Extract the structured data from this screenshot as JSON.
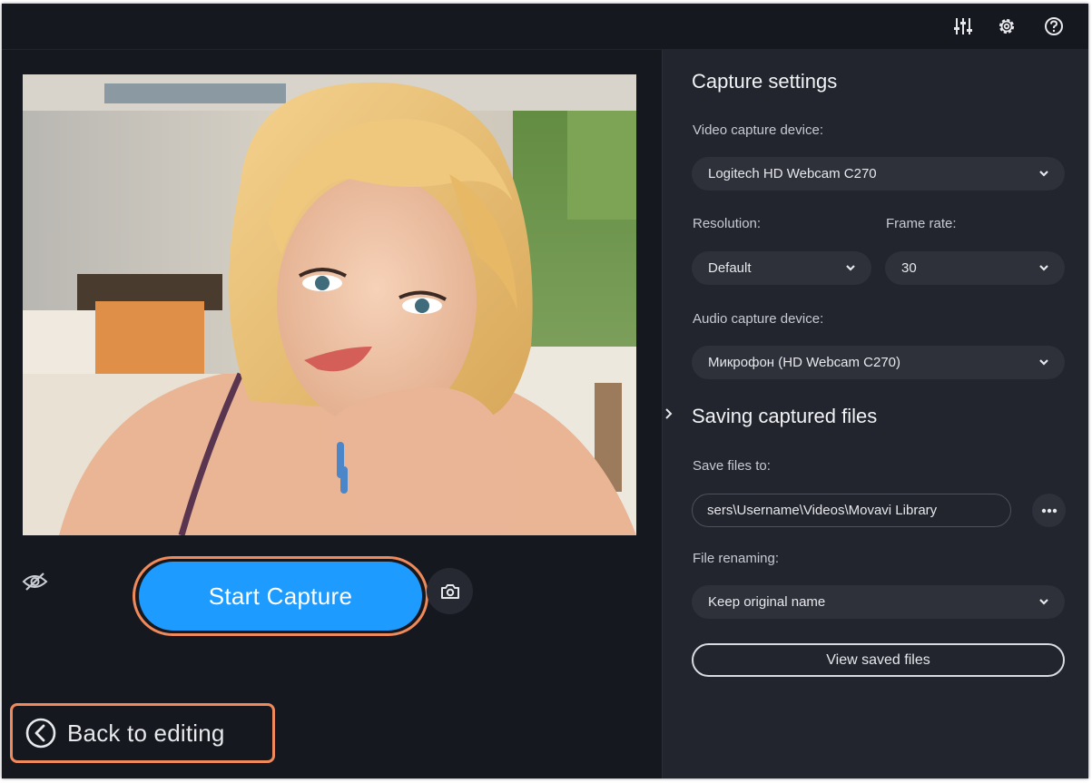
{
  "toolbar": {
    "icons": [
      "mixer-icon",
      "gear-icon",
      "help-icon"
    ]
  },
  "preview": {
    "description_icon": "webcam-preview-image"
  },
  "controls": {
    "start_capture_label": "Start Capture",
    "back_label": "Back to editing",
    "mute_icon": "eye-off-icon",
    "snapshot_icon": "camera-icon"
  },
  "capture_settings": {
    "title": "Capture settings",
    "video_device_label": "Video capture device:",
    "video_device_value": "Logitech HD Webcam C270",
    "resolution_label": "Resolution:",
    "resolution_value": "Default",
    "frame_rate_label": "Frame rate:",
    "frame_rate_value": "30",
    "audio_device_label": "Audio capture device:",
    "audio_device_value": "Микрофон (HD Webcam C270)"
  },
  "saving": {
    "title": "Saving captured files",
    "save_to_label": "Save files to:",
    "save_to_value": "sers\\Username\\Videos\\Movavi Library",
    "renaming_label": "File renaming:",
    "renaming_value": "Keep original name",
    "view_button_label": "View saved files"
  },
  "colors": {
    "accent": "#1e9bff",
    "highlight": "#f08a5a",
    "panel": "#22252e",
    "background": "#16181f"
  }
}
